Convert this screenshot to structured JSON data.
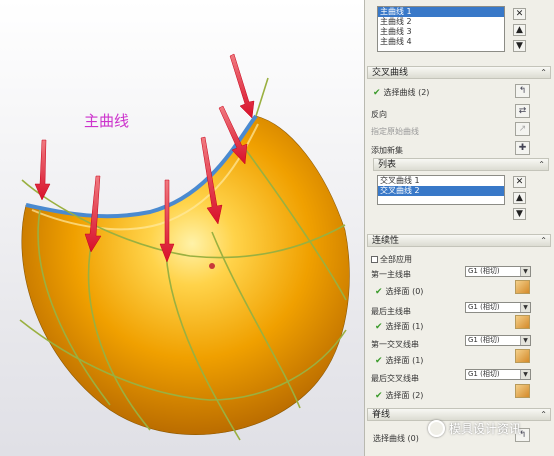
{
  "viewport": {
    "label": "主曲线"
  },
  "primary_list": {
    "items": [
      "主曲线 1",
      "主曲线 2",
      "主曲线 3",
      "主曲线 4"
    ],
    "selected_index": 0
  },
  "cross_section": {
    "header": "交叉曲线",
    "select_curve": "选择曲线 (2)",
    "reverse": "反向",
    "specify_origin": "指定原始曲线",
    "add_set": "添加新集",
    "list_header": "列表",
    "items": [
      "交叉曲线 1",
      "交叉曲线 2"
    ],
    "selected_index": 1
  },
  "continuity": {
    "header": "连续性",
    "apply_all": "全部应用",
    "first_primary": "第一主线串",
    "last_primary": "最后主线串",
    "first_cross": "第一交叉线串",
    "last_cross": "最后交叉线串",
    "option": "G1 (相切)",
    "select_face_0": "选择面 (0)",
    "select_face_1": "选择面 (1)",
    "select_face_1b": "选择面 (1)",
    "select_face_2": "选择面 (2)"
  },
  "spine": {
    "header": "脊线",
    "select_curve": "选择曲线 (0)"
  },
  "watermark": "模具设计资讯",
  "colors": {
    "surface": "#f0a000",
    "edge_blue": "#4a8ad0",
    "arrow_red": "#e8303a",
    "curve_green": "#9ab040",
    "label_magenta": "#cc33cc"
  }
}
